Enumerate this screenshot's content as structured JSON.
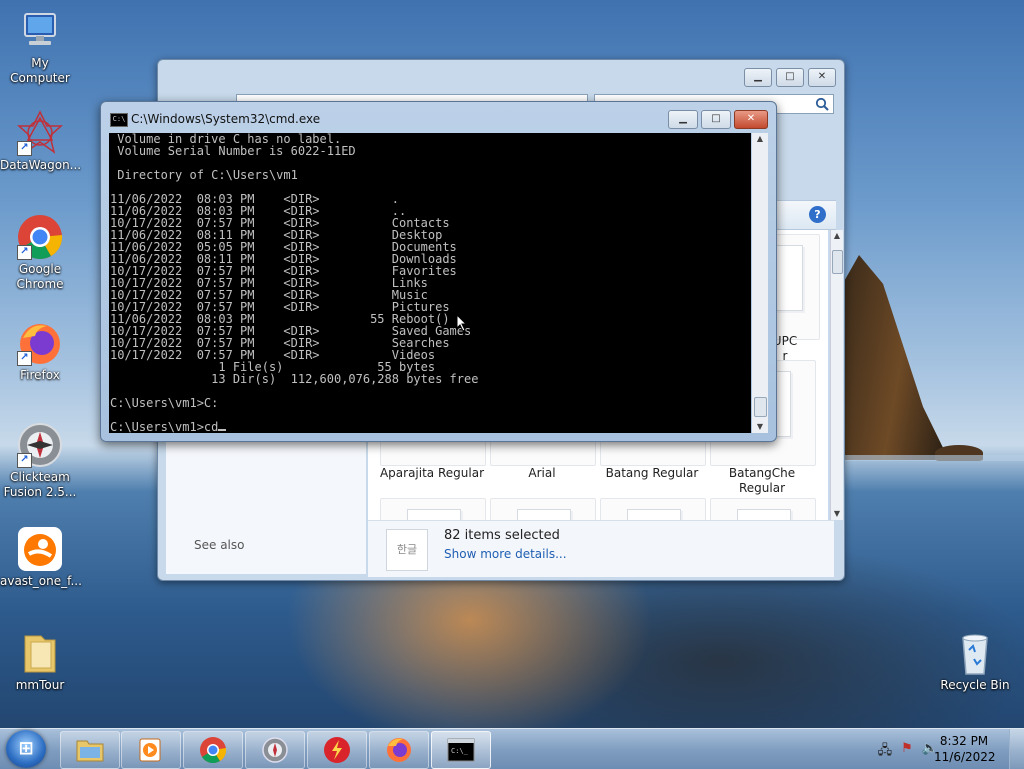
{
  "desktop": {
    "icons": [
      {
        "label": "My Computer",
        "icon": "computer-icon"
      },
      {
        "label": "DataWagon...",
        "icon": "datawagon-icon"
      },
      {
        "label": "Google Chrome",
        "icon": "chrome-icon"
      },
      {
        "label": "Firefox",
        "icon": "firefox-icon"
      },
      {
        "label": "Clickteam Fusion 2.5...",
        "icon": "clickteam-icon"
      },
      {
        "label": "avast_one_f...",
        "icon": "avast-icon"
      },
      {
        "label": "mmTour",
        "icon": "folder-icon"
      }
    ],
    "recycle_bin": "Recycle Bin"
  },
  "explorer": {
    "see_also": "See also",
    "fonts": [
      {
        "name": "Aparajita Regular"
      },
      {
        "name": "Arial"
      },
      {
        "name": "Batang Regular"
      },
      {
        "name": "BatangChe Regular"
      }
    ],
    "partial_font_label": "UPC\nr",
    "details": {
      "thumb_text": "한글",
      "selected_count": "82 items selected",
      "more_link": "Show more details..."
    }
  },
  "cmd": {
    "title": "C:\\Windows\\System32\\cmd.exe",
    "lines": [
      " Volume in drive C has no label.",
      " Volume Serial Number is 6022-11ED",
      "",
      " Directory of C:\\Users\\vm1",
      "",
      "11/06/2022  08:03 PM    <DIR>          .",
      "11/06/2022  08:03 PM    <DIR>          ..",
      "10/17/2022  07:57 PM    <DIR>          Contacts",
      "11/06/2022  08:11 PM    <DIR>          Desktop",
      "11/06/2022  05:05 PM    <DIR>          Documents",
      "11/06/2022  08:11 PM    <DIR>          Downloads",
      "10/17/2022  07:57 PM    <DIR>          Favorites",
      "10/17/2022  07:57 PM    <DIR>          Links",
      "10/17/2022  07:57 PM    <DIR>          Music",
      "10/17/2022  07:57 PM    <DIR>          Pictures",
      "11/06/2022  08:03 PM                55 Reboot()",
      "10/17/2022  07:57 PM    <DIR>          Saved Games",
      "10/17/2022  07:57 PM    <DIR>          Searches",
      "10/17/2022  07:57 PM    <DIR>          Videos",
      "               1 File(s)             55 bytes",
      "              13 Dir(s)  112,600,076,288 bytes free",
      "",
      "C:\\Users\\vm1>C:",
      ""
    ],
    "prompt": "C:\\Users\\vm1>cd"
  },
  "taskbar": {
    "start_label": "Start",
    "buttons": [
      {
        "icon": "explorer-icon",
        "active": false
      },
      {
        "icon": "media-player-icon",
        "active": false
      },
      {
        "icon": "chrome-icon",
        "active": false
      },
      {
        "icon": "clickteam-icon",
        "active": false
      },
      {
        "icon": "flash-icon",
        "active": false
      },
      {
        "icon": "firefox-icon",
        "active": false
      },
      {
        "icon": "cmd-icon",
        "active": true
      }
    ],
    "time": "8:32 PM",
    "date": "11/6/2022"
  },
  "colors": {
    "console_bg": "#000000",
    "console_fg": "#c0c0c0",
    "link": "#1f5fb3",
    "taskbar": "#7e9cbf"
  }
}
